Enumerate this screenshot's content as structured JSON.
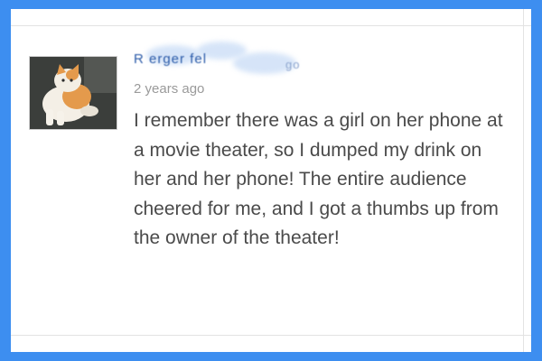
{
  "comment": {
    "username": "R   erger fel",
    "username_suffix": "go",
    "timestamp": "2 years ago",
    "body": "I remember there was a girl on her phone at a movie theater, so I dumped my drink on her and her phone! The entire audience cheered for me, and I got a thumbs up from the owner of the theater!"
  },
  "colors": {
    "frame": "#3d8ef0",
    "username": "#2a5aa8",
    "timestamp": "#9a9a9a",
    "body": "#4a4a4a"
  },
  "icons": {
    "avatar": "cat-photo"
  }
}
